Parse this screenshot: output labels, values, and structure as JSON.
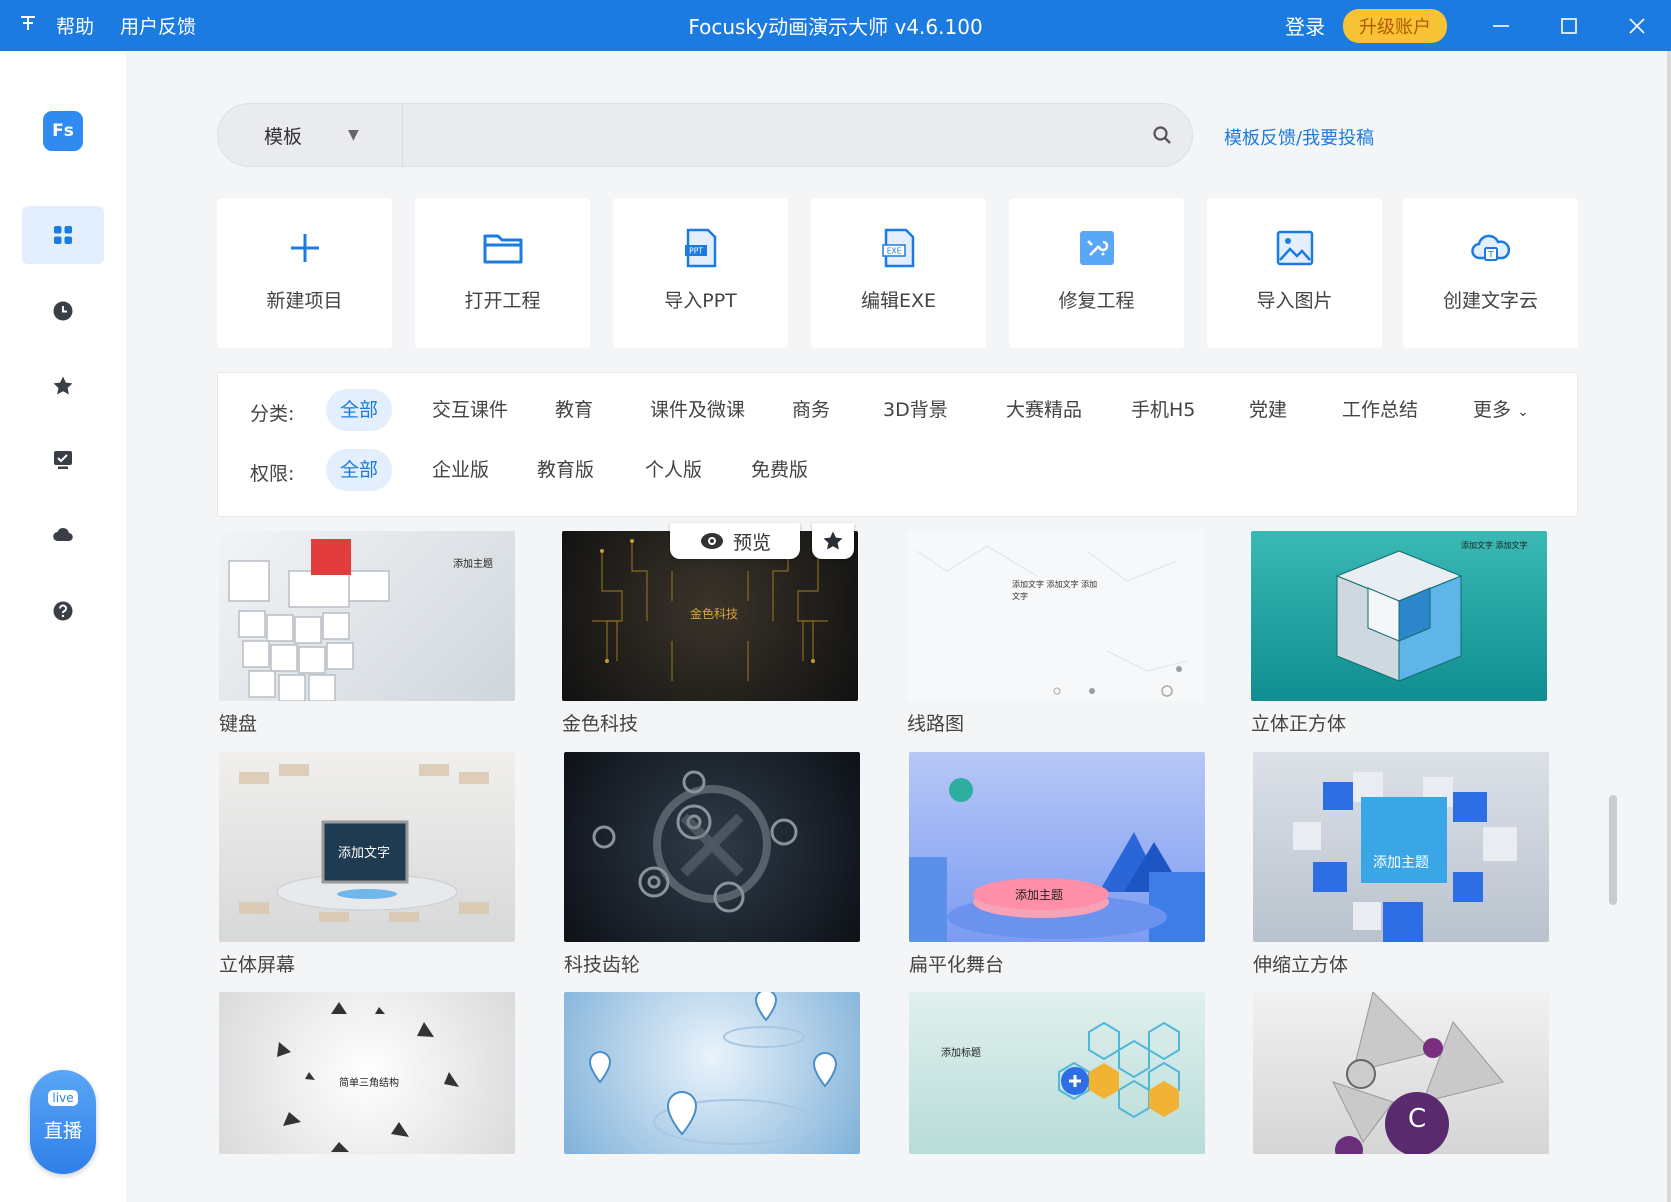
{
  "titlebar": {
    "pin_icon": "pin-icon",
    "help": "帮助",
    "feedback": "用户反馈",
    "title": "Focusky动画演示大师 v4.6.100",
    "login": "登录",
    "upgrade": "升级账户",
    "minimize": "—",
    "maximize": "☐",
    "close": "✕",
    "bar_color": "#1b7be0"
  },
  "sidebar": {
    "logo": "Fs",
    "items": [
      {
        "icon": "grid-icon"
      },
      {
        "icon": "clock-icon"
      },
      {
        "icon": "star-icon"
      },
      {
        "icon": "checklist-icon"
      },
      {
        "icon": "cloud-icon"
      },
      {
        "icon": "help-icon"
      }
    ],
    "live": {
      "tag": "live",
      "label": "直播"
    }
  },
  "search": {
    "type": "模板",
    "placeholder": "",
    "feedback_link": "模板反馈/我要投稿"
  },
  "actions": [
    {
      "label": "新建项目",
      "icon": "plus-icon"
    },
    {
      "label": "打开工程",
      "icon": "folder-icon"
    },
    {
      "label": "导入PPT",
      "icon": "ppt-file-icon"
    },
    {
      "label": "编辑EXE",
      "icon": "exe-file-icon"
    },
    {
      "label": "修复工程",
      "icon": "repair-icon"
    },
    {
      "label": "导入图片",
      "icon": "image-icon"
    },
    {
      "label": "创建文字云",
      "icon": "word-cloud-icon"
    }
  ],
  "filters": {
    "category_label": "分类:",
    "categories": [
      "全部",
      "交互课件",
      "教育",
      "课件及微课",
      "商务",
      "3D背景",
      "大赛精品",
      "手机H5",
      "党建",
      "工作总结",
      "更多"
    ],
    "permission_label": "权限:",
    "permissions": [
      "全部",
      "企业版",
      "教育版",
      "个人版",
      "免费版"
    ]
  },
  "hover": {
    "preview": "预览"
  },
  "templates": [
    {
      "name": "键盘",
      "thumb_text": "添加主题"
    },
    {
      "name": "金色科技",
      "thumb_text": "金色科技"
    },
    {
      "name": "线路图",
      "thumb_text": "添加文字 添加文字 添加文字"
    },
    {
      "name": "立体正方体",
      "thumb_text": "添加文字 添加文字"
    },
    {
      "name": "立体屏幕",
      "thumb_text": "添加文字"
    },
    {
      "name": "科技齿轮",
      "thumb_text": ""
    },
    {
      "name": "扁平化舞台",
      "thumb_text": "添加主题"
    },
    {
      "name": "伸缩立方体",
      "thumb_text": "添加主题"
    },
    {
      "name": "",
      "thumb_text": "简单三角结构"
    },
    {
      "name": "",
      "thumb_text": ""
    },
    {
      "name": "",
      "thumb_text": "添加标题"
    },
    {
      "name": "",
      "thumb_text": "C"
    }
  ]
}
